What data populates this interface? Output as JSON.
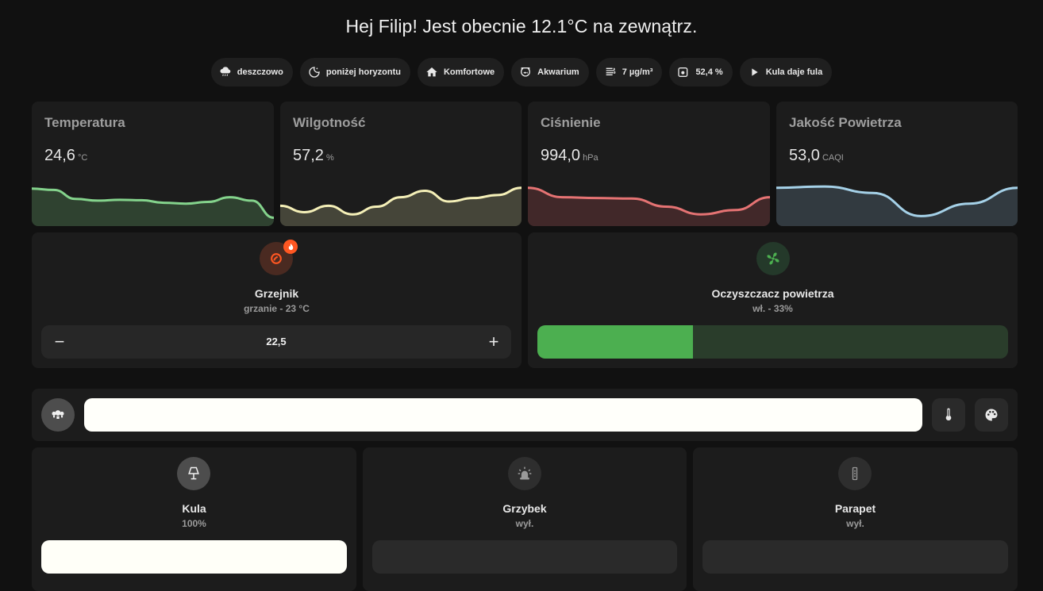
{
  "greeting": "Hej Filip! Jest obecnie 12.1°C na zewnątrz.",
  "chips": [
    {
      "icon": "weather-rainy-icon",
      "label": "deszczowo"
    },
    {
      "icon": "moon-icon",
      "label": "poniżej horyzontu"
    },
    {
      "icon": "home-icon",
      "label": "Komfortowe"
    },
    {
      "icon": "fishbowl-icon",
      "label": "Akwarium"
    },
    {
      "icon": "air-filter-icon",
      "label": "7 µg/m³"
    },
    {
      "icon": "water-percent-icon",
      "label": "52,4 %"
    },
    {
      "icon": "play-icon",
      "label": "Kula daje fula"
    }
  ],
  "sensors": [
    {
      "title": "Temperatura",
      "value": "24,6",
      "unit": "°C",
      "color": "#84d38c",
      "fill": "#2f4230",
      "history": [
        0.8,
        0.77,
        0.56,
        0.52,
        0.54,
        0.53,
        0.47,
        0.45,
        0.49,
        0.6,
        0.52,
        0.12
      ]
    },
    {
      "title": "Wilgotność",
      "value": "57,2",
      "unit": "%",
      "color": "#f5f0b8",
      "fill": "#454539",
      "history": [
        0.4,
        0.25,
        0.4,
        0.2,
        0.38,
        0.6,
        0.75,
        0.5,
        0.58,
        0.65,
        0.82
      ]
    },
    {
      "title": "Ciśnienie",
      "value": "994,0",
      "unit": "hPa",
      "color": "#e57373",
      "fill": "#412829",
      "history": [
        0.82,
        0.6,
        0.58,
        0.57,
        0.38,
        0.2,
        0.3,
        0.6
      ]
    },
    {
      "title": "Jakość Powietrza",
      "value": "53,0",
      "unit": "CAQI",
      "color": "#a5d1e8",
      "fill": "#323a40",
      "history": [
        0.82,
        0.85,
        0.7,
        0.16,
        0.45,
        0.82
      ]
    }
  ],
  "heater": {
    "name": "Grzejnik",
    "state": "grzanie - 23 °C",
    "target": "22,5",
    "accent": "#ff5722",
    "minus": "−",
    "plus": "+"
  },
  "purifier": {
    "name": "Oczyszczacz powietrza",
    "state": "wł. - 33%",
    "level": 0.33,
    "accent": "#4caf50"
  },
  "lights_group": {
    "brightness": 1.0
  },
  "lights": [
    {
      "name": "Kula",
      "state": "100%",
      "on": true,
      "icon": "lamp-icon"
    },
    {
      "name": "Grzybek",
      "state": "wył.",
      "on": false,
      "icon": "alarm-light-icon"
    },
    {
      "name": "Parapet",
      "state": "wył.",
      "on": false,
      "icon": "led-strip-icon"
    }
  ]
}
